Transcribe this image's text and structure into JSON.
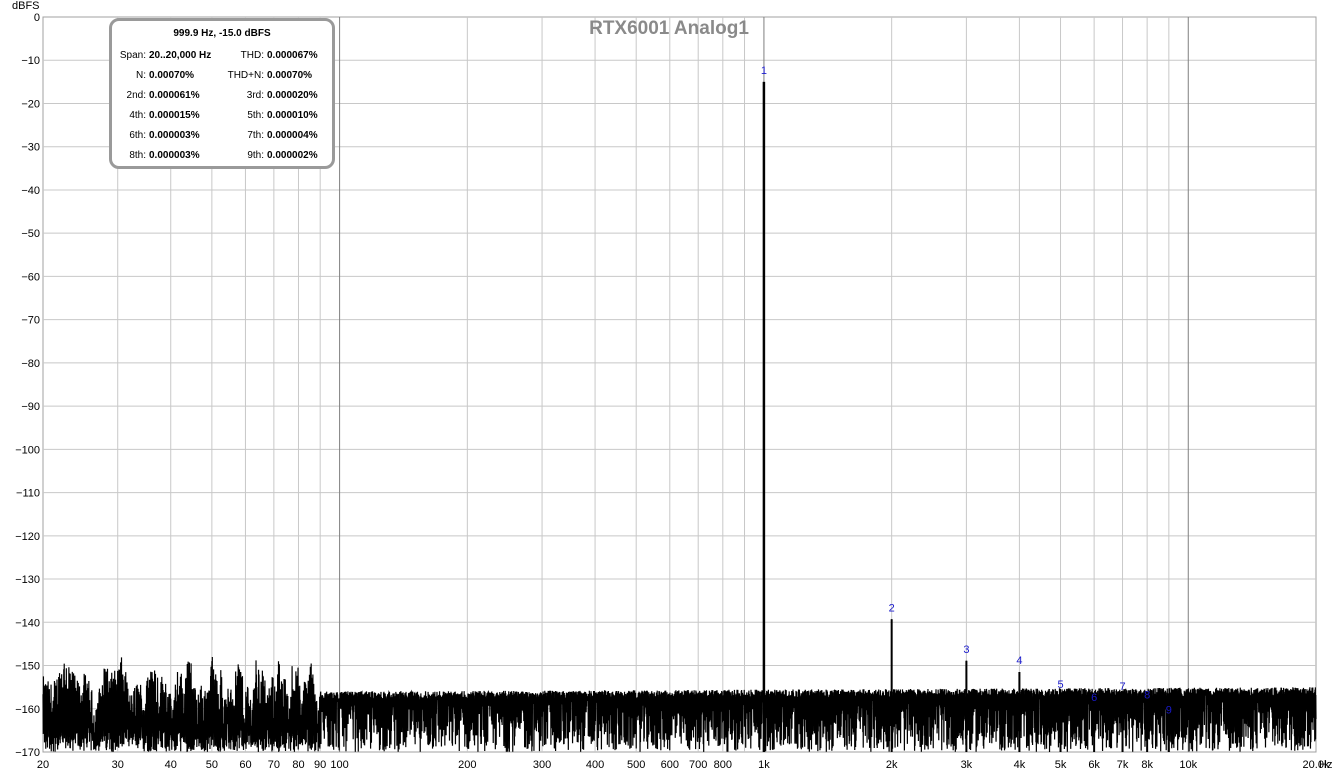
{
  "chart_data": {
    "type": "line",
    "title": "RTX6001 Analog1",
    "ylabel": "dBFS",
    "xlabel": "Hz",
    "x_scale": "log",
    "xlim": [
      20,
      20000
    ],
    "ylim": [
      -170,
      0
    ],
    "grid": true,
    "y_ticks": [
      0,
      -10,
      -20,
      -30,
      -40,
      -50,
      -60,
      -70,
      -80,
      -90,
      -100,
      -110,
      -120,
      -130,
      -140,
      -150,
      -160,
      -170
    ],
    "x_ticks": [
      {
        "value": 20,
        "label": "20"
      },
      {
        "value": 30,
        "label": "30"
      },
      {
        "value": 40,
        "label": "40"
      },
      {
        "value": 50,
        "label": "50"
      },
      {
        "value": 60,
        "label": "60"
      },
      {
        "value": 70,
        "label": "70"
      },
      {
        "value": 80,
        "label": "80"
      },
      {
        "value": 90,
        "label": "90"
      },
      {
        "value": 100,
        "label": "100"
      },
      {
        "value": 200,
        "label": "200"
      },
      {
        "value": 300,
        "label": "300"
      },
      {
        "value": 400,
        "label": "400"
      },
      {
        "value": 500,
        "label": "500"
      },
      {
        "value": 600,
        "label": "600"
      },
      {
        "value": 700,
        "label": "700"
      },
      {
        "value": 800,
        "label": "800"
      },
      {
        "value": 1000,
        "label": "1k"
      },
      {
        "value": 2000,
        "label": "2k"
      },
      {
        "value": 3000,
        "label": "3k"
      },
      {
        "value": 4000,
        "label": "4k"
      },
      {
        "value": 5000,
        "label": "5k"
      },
      {
        "value": 6000,
        "label": "6k"
      },
      {
        "value": 7000,
        "label": "7k"
      },
      {
        "value": 8000,
        "label": "8k"
      },
      {
        "value": 10000,
        "label": "10k"
      },
      {
        "value": 20000,
        "label": "20.0k"
      }
    ],
    "harmonics": [
      {
        "label": "1",
        "x": 999.9,
        "y": -15.0
      },
      {
        "label": "2",
        "x": 2000,
        "y": -139.3
      },
      {
        "label": "3",
        "x": 3000,
        "y": -148.9
      },
      {
        "label": "4",
        "x": 4000,
        "y": -151.5
      },
      {
        "label": "5",
        "x": 5000,
        "y": -157.0
      },
      {
        "label": "6",
        "x": 6000,
        "y": -160.0
      },
      {
        "label": "7",
        "x": 7000,
        "y": -157.5
      },
      {
        "label": "8",
        "x": 8000,
        "y": -159.5
      },
      {
        "label": "9",
        "x": 9000,
        "y": -163.0
      }
    ],
    "noise_floor": {
      "low_freq_range": [
        20,
        90
      ],
      "low_freq_level_range": [
        -170,
        -148
      ],
      "level_at_100hz": [
        -170,
        -156
      ],
      "level_at_20khz": [
        -170,
        -155
      ]
    },
    "info_box": {
      "header": "999.9 Hz, -15.0 dBFS",
      "rows": [
        [
          {
            "label": "Span:",
            "value": "20..20,000 Hz"
          },
          {
            "label": "THD:",
            "value": "0.000067%"
          }
        ],
        [
          {
            "label": "N:",
            "value": "0.00070%"
          },
          {
            "label": "THD+N:",
            "value": "0.00070%"
          }
        ],
        [
          {
            "label": "2nd:",
            "value": "0.000061%"
          },
          {
            "label": "3rd:",
            "value": "0.000020%"
          }
        ],
        [
          {
            "label": "4th:",
            "value": "0.000015%"
          },
          {
            "label": "5th:",
            "value": "0.000010%"
          }
        ],
        [
          {
            "label": "6th:",
            "value": "0.000003%"
          },
          {
            "label": "7th:",
            "value": "0.000004%"
          }
        ],
        [
          {
            "label": "8th:",
            "value": "0.000003%"
          },
          {
            "label": "9th:",
            "value": "0.000002%"
          }
        ]
      ]
    },
    "colors": {
      "trace": "#000000",
      "grid": "#c8c8c8",
      "decade_grid": "#808080",
      "harmonic_label": "#1a1acc",
      "title": "#8a8a8a"
    }
  }
}
